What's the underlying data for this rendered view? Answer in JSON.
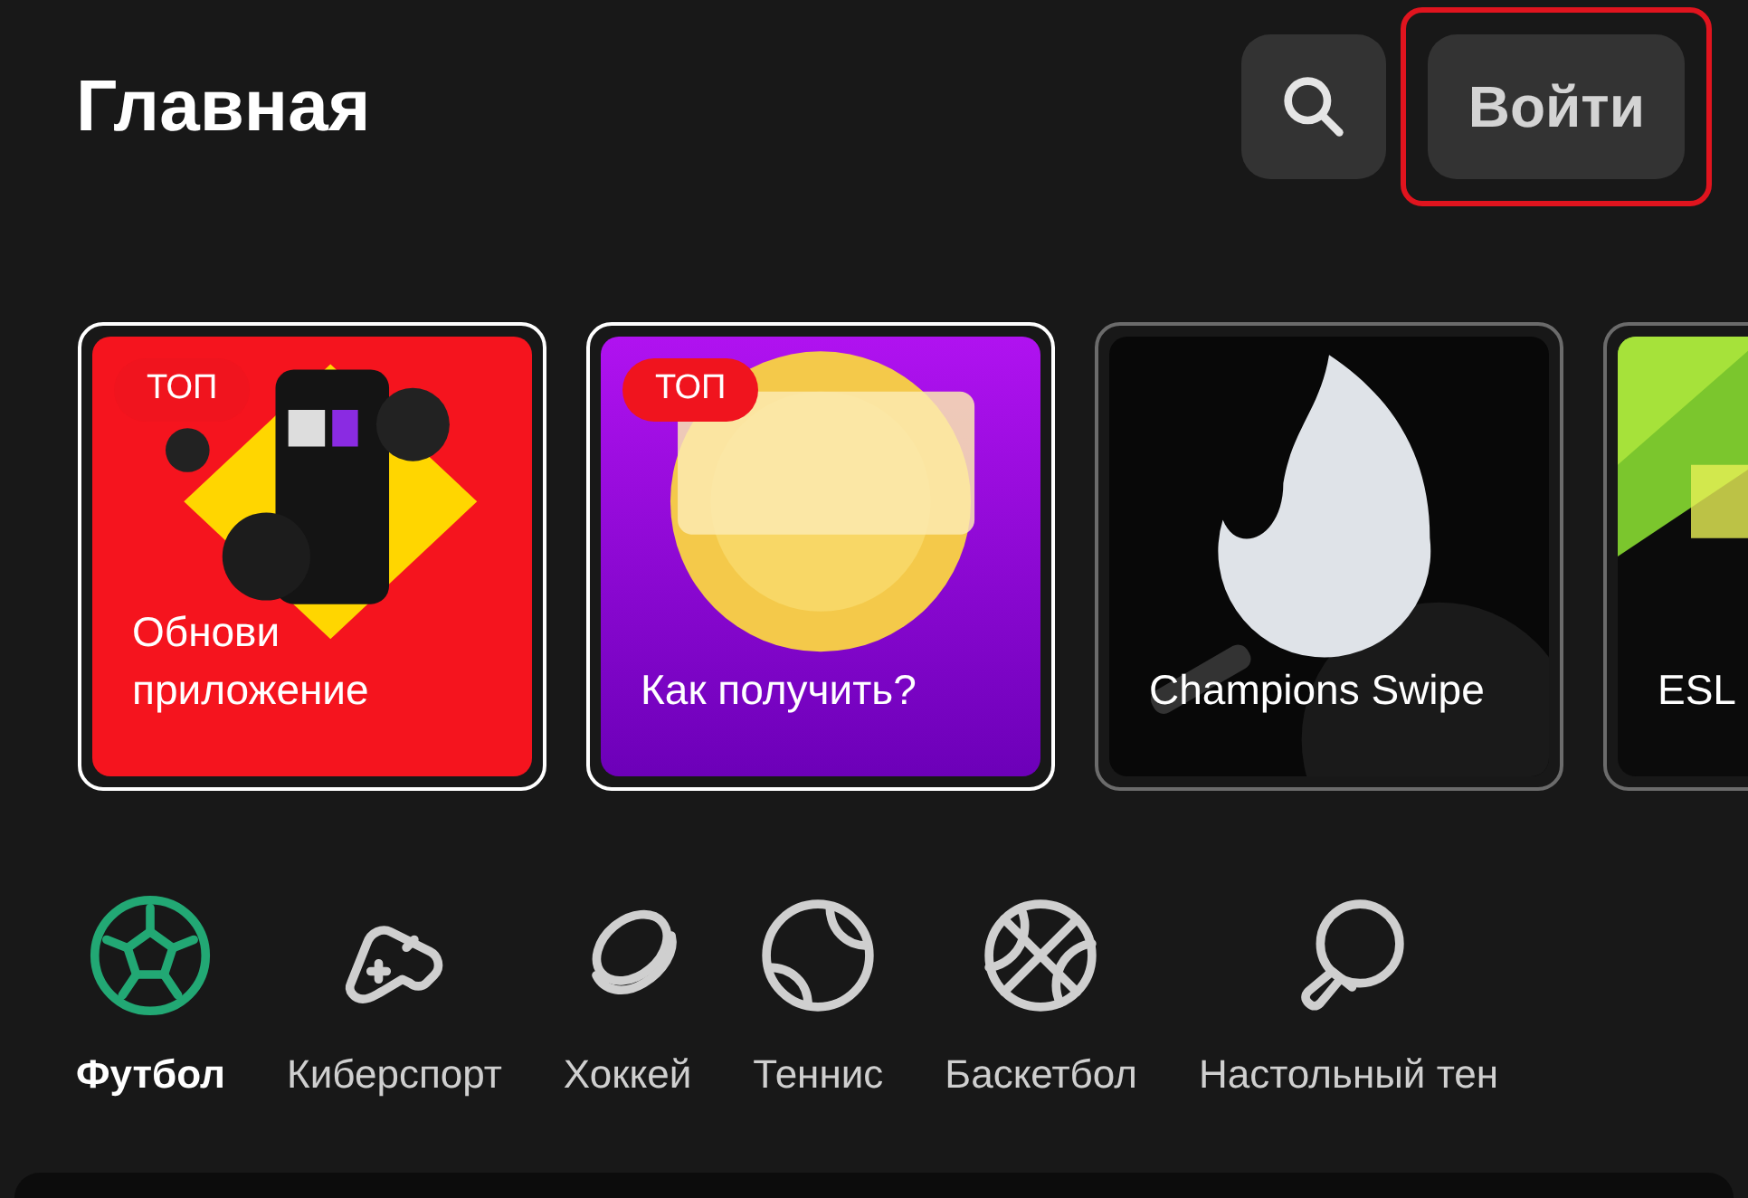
{
  "header": {
    "title": "Главная",
    "login_button": "Войти",
    "login_highlighted": true
  },
  "banners": [
    {
      "badge": "ТОП",
      "title": "Обнови приложение",
      "selected": true
    },
    {
      "badge": "ТОП",
      "title": "Как получить?",
      "selected": true
    },
    {
      "title": "Champions Swipe",
      "selected": false
    },
    {
      "title": "ESL",
      "selected": false
    }
  ],
  "sports": [
    {
      "kind": "football",
      "label": "Футбол",
      "selected": true
    },
    {
      "kind": "esports",
      "label": "Киберспорт",
      "selected": false
    },
    {
      "kind": "hockey",
      "label": "Хоккей",
      "selected": false
    },
    {
      "kind": "tennis",
      "label": "Теннис",
      "selected": false
    },
    {
      "kind": "basketball",
      "label": "Баскетбол",
      "selected": false
    },
    {
      "kind": "table_tennis",
      "label": "Настольный тен",
      "selected": false
    }
  ]
}
